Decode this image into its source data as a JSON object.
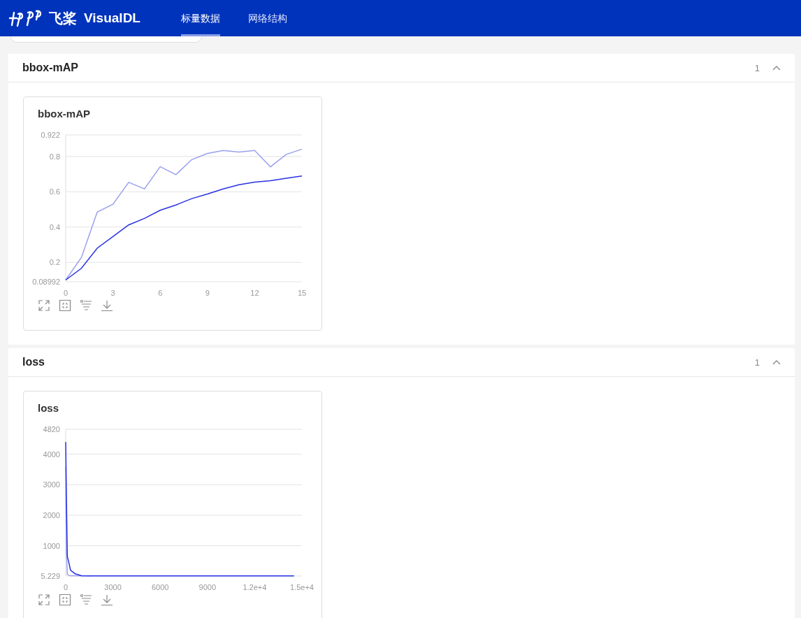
{
  "header": {
    "logo_text": "飞桨",
    "app_name": "VisualDL",
    "tabs": [
      {
        "label": "标量数据",
        "selected": true
      },
      {
        "label": "网络结构",
        "selected": false
      }
    ]
  },
  "sections": [
    {
      "title": "bbox-mAP",
      "count": "1",
      "expanded": true,
      "charts": [
        {
          "title": "bbox-mAP",
          "chart_data": {
            "type": "line",
            "x": [
              0,
              1,
              2,
              3,
              4,
              5,
              6,
              7,
              8,
              9,
              10,
              11,
              12,
              13,
              14,
              15
            ],
            "series": [
              {
                "color": "#9aa0ee",
                "values": [
                  0.1,
                  0.228,
                  0.485,
                  0.529,
                  0.653,
                  0.616,
                  0.742,
                  0.697,
                  0.782,
                  0.817,
                  0.834,
                  0.825,
                  0.834,
                  0.741,
                  0.812,
                  0.841
                ]
              },
              {
                "color": "#2932e1",
                "values": [
                  0.1,
                  0.166,
                  0.28,
                  0.346,
                  0.412,
                  0.449,
                  0.495,
                  0.525,
                  0.561,
                  0.587,
                  0.616,
                  0.64,
                  0.655,
                  0.663,
                  0.676,
                  0.689
                ]
              }
            ],
            "grid": true,
            "xlim": [
              0,
              15
            ],
            "ylim": [
              0.08992,
              0.922
            ],
            "xticks": [
              0,
              3,
              6,
              9,
              12,
              15
            ],
            "yticks": [
              {
                "value": 0.08992,
                "label": "0.08992"
              },
              0.2,
              0.4,
              0.6,
              0.8,
              {
                "value": 0.922,
                "label": "0.922"
              }
            ]
          }
        }
      ]
    },
    {
      "title": "loss",
      "count": "1",
      "expanded": true,
      "charts": [
        {
          "title": "loss",
          "chart_data": {
            "type": "line",
            "x": [
              0,
              50,
              100,
              200,
              300,
              600,
              1000,
              1600,
              3000,
              6000,
              9000,
              12000,
              14500
            ],
            "series": [
              {
                "color": "#9aa0ee",
                "values": [
                  3600,
                  800,
                  60,
                  30,
                  20,
                  20,
                  10,
                  10,
                  null,
                  null,
                  null,
                  null,
                  null
                ]
              },
              {
                "color": "#2932e1",
                "values": [
                  4400,
                  2500,
                  650,
                  450,
                  200,
                  80,
                  20,
                  10,
                  10,
                  10,
                  10,
                  10,
                  10
                ]
              }
            ],
            "grid": true,
            "xlim": [
              0,
              15000
            ],
            "ylim": [
              5.229,
              4820
            ],
            "xticks": [
              0,
              3000,
              6000,
              9000,
              {
                "value": 12000,
                "label": "1.2e+4"
              },
              {
                "value": 15000,
                "label": "1.5e+4"
              }
            ],
            "yticks": [
              {
                "value": 5.229,
                "label": "5.229"
              },
              1000,
              2000,
              3000,
              4000,
              4820
            ]
          }
        }
      ]
    }
  ]
}
